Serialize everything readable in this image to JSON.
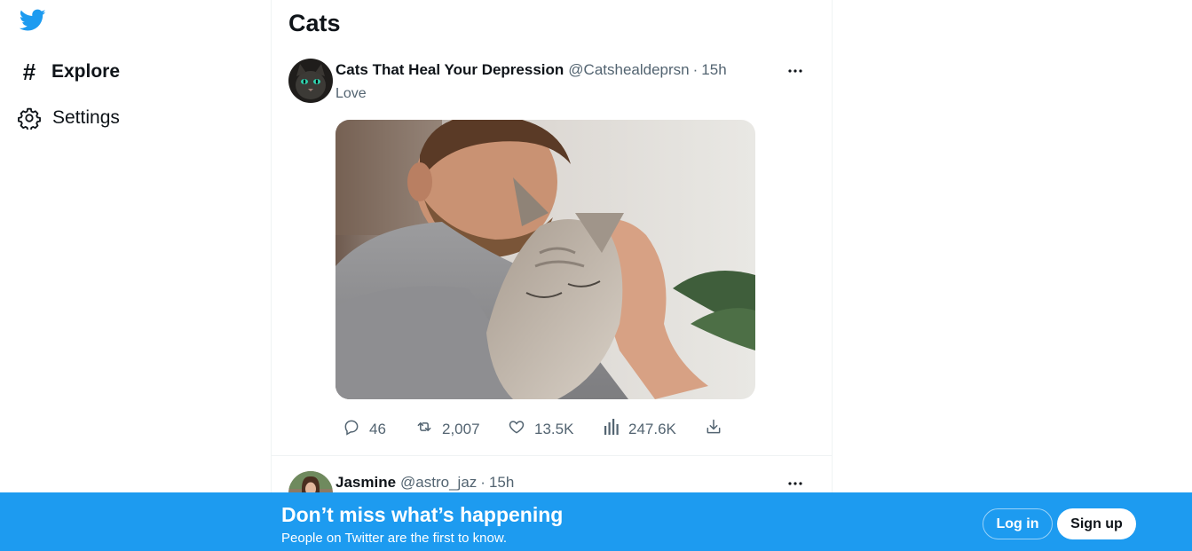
{
  "nav": {
    "logo_icon": "twitter-bird-icon",
    "items": [
      {
        "label": "Explore",
        "icon": "hashtag-icon",
        "active": true
      },
      {
        "label": "Settings",
        "icon": "gear-icon",
        "active": false
      }
    ]
  },
  "column": {
    "title": "Cats"
  },
  "tweets": [
    {
      "author": "Cats That Heal Your Depression",
      "handle": "@Catshealdeprsn",
      "separator": "·",
      "time": "15h",
      "text": "Love",
      "media_icon": "photo-man-hugging-cat",
      "actions": {
        "replies": "46",
        "retweets": "2,007",
        "likes": "13.5K",
        "views": "247.6K"
      }
    },
    {
      "author": "Jasmine",
      "handle": "@astro_jaz",
      "separator": "·",
      "time": "15h"
    }
  ],
  "banner": {
    "title": "Don’t miss what’s happening",
    "subtitle": "People on Twitter are the first to know.",
    "login_label": "Log in",
    "signup_label": "Sign up"
  },
  "colors": {
    "brand": "#1d9bf0",
    "text_primary": "#0f1419",
    "text_secondary": "#536471",
    "border": "#eff3f4"
  }
}
